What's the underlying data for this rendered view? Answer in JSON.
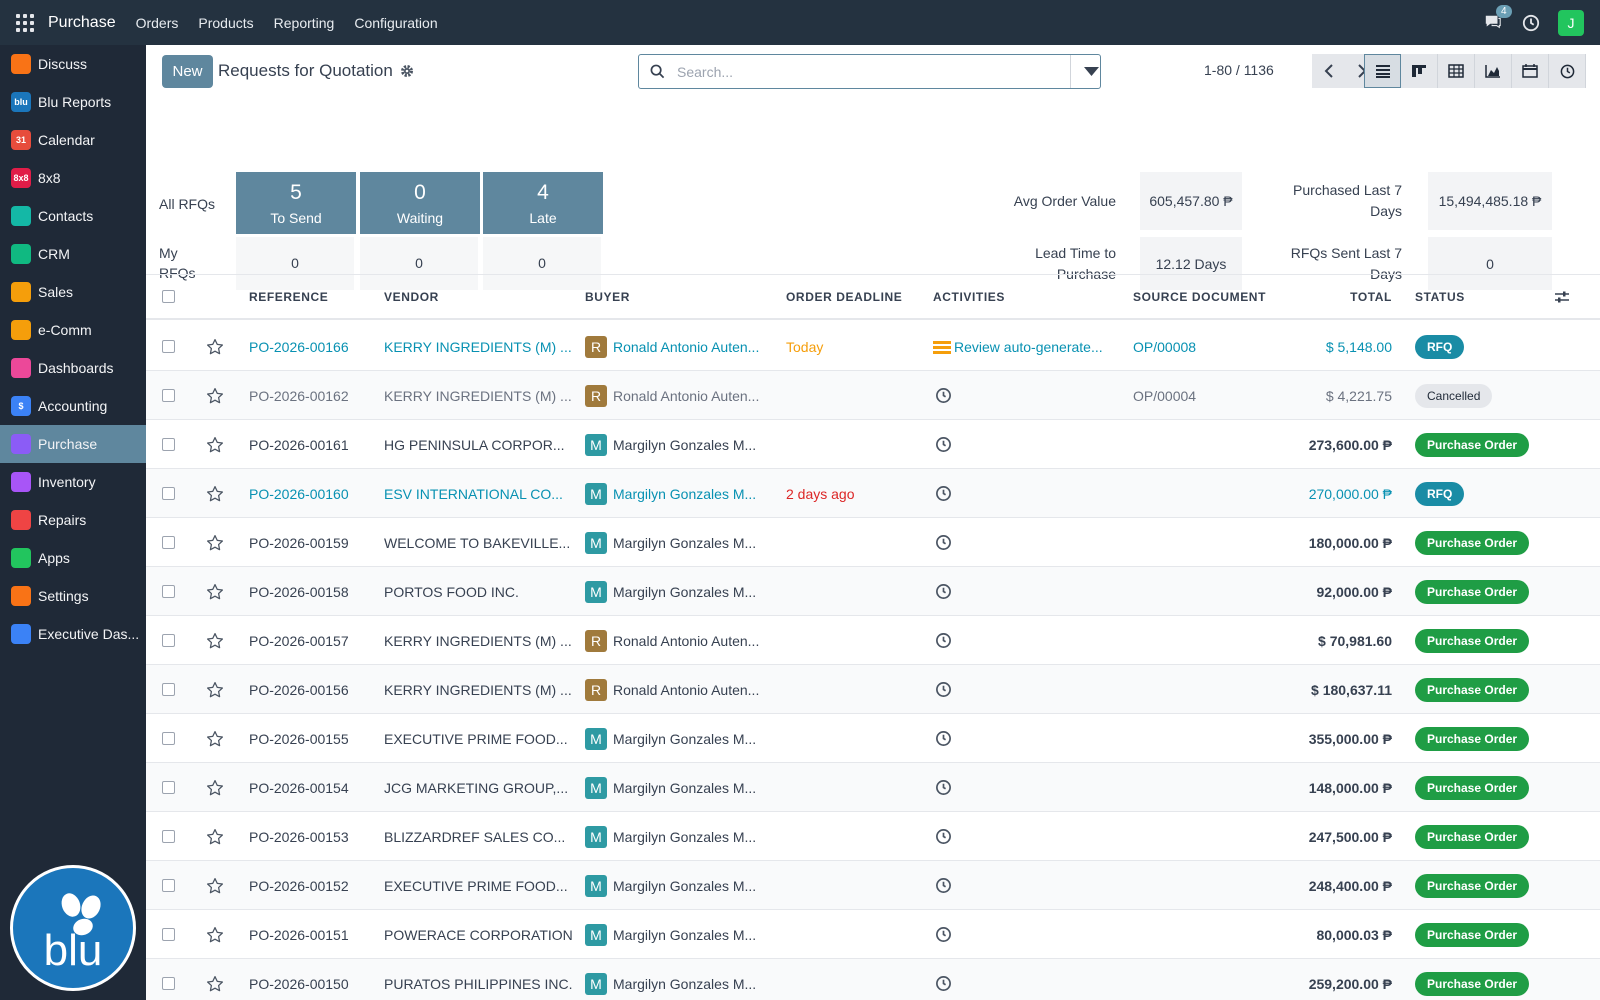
{
  "topbar": {
    "app_name": "Purchase",
    "menus": [
      "Orders",
      "Products",
      "Reporting",
      "Configuration"
    ],
    "chat_count": "4",
    "user_initial": "J"
  },
  "sidebar": {
    "items": [
      {
        "label": "Discuss",
        "icon": "discuss-icon",
        "color": "#f97316"
      },
      {
        "label": "Blu Reports",
        "icon": "blu-reports-icon",
        "color": "#1b76bb"
      },
      {
        "label": "Calendar",
        "icon": "calendar-icon",
        "color": "#e74c3c"
      },
      {
        "label": "8x8",
        "icon": "8x8-icon",
        "color": "#e11d48"
      },
      {
        "label": "Contacts",
        "icon": "contacts-icon",
        "color": "#14b8a6"
      },
      {
        "label": "CRM",
        "icon": "crm-icon",
        "color": "#10b981"
      },
      {
        "label": "Sales",
        "icon": "sales-icon",
        "color": "#f59e0b"
      },
      {
        "label": "e-Comm",
        "icon": "ecomm-icon",
        "color": "#f59e0b"
      },
      {
        "label": "Dashboards",
        "icon": "dashboards-icon",
        "color": "#ec4899"
      },
      {
        "label": "Accounting",
        "icon": "accounting-icon",
        "color": "#3b82f6"
      },
      {
        "label": "Purchase",
        "icon": "purchase-icon",
        "color": "#8b5cf6"
      },
      {
        "label": "Inventory",
        "icon": "inventory-icon",
        "color": "#a855f7"
      },
      {
        "label": "Repairs",
        "icon": "repairs-icon",
        "color": "#ef4444"
      },
      {
        "label": "Apps",
        "icon": "apps-grid-icon",
        "color": "#22c55e"
      },
      {
        "label": "Settings",
        "icon": "settings-icon",
        "color": "#f97316"
      },
      {
        "label": "Executive Das...",
        "icon": "executive-dashboard-icon",
        "color": "#3b82f6"
      }
    ],
    "active_index": 10,
    "logo_text": "blu"
  },
  "control": {
    "new_label": "New",
    "title": "Requests for Quotation",
    "search_placeholder": "Search...",
    "pager": "1-80 / 1136"
  },
  "dashboard": {
    "all_rfqs_label": "All RFQs",
    "my_rfqs_label": "My RFQs",
    "tiles": [
      {
        "count": "5",
        "label": "To Send"
      },
      {
        "count": "0",
        "label": "Waiting"
      },
      {
        "count": "4",
        "label": "Late"
      }
    ],
    "my_counts": [
      "0",
      "0",
      "0"
    ],
    "stats": {
      "avg_order_label": "Avg Order Value",
      "avg_order_value": "605,457.80 ₱",
      "purchased_label": "Purchased Last 7 Days",
      "purchased_value": "15,494,485.18 ₱",
      "lead_time_label": "Lead Time to Purchase",
      "lead_time_value": "12.12 Days",
      "rfqs_sent_label": "RFQs Sent Last 7 Days",
      "rfqs_sent_value": "0"
    }
  },
  "table": {
    "headers": [
      "REFERENCE",
      "VENDOR",
      "BUYER",
      "ORDER DEADLINE",
      "ACTIVITIES",
      "SOURCE DOCUMENT",
      "TOTAL",
      "STATUS"
    ],
    "rows": [
      {
        "ref": "PO-2026-00166",
        "vendor": "KERRY INGREDIENTS (M) ...",
        "buyer_initial": "R",
        "buyer": "Ronald Antonio Auten...",
        "deadline": "Today",
        "activity": "Review auto-generate...",
        "source": "OP/00008",
        "total": "$ 5,148.00",
        "status": "RFQ",
        "style": "highlight"
      },
      {
        "ref": "PO-2026-00162",
        "vendor": "KERRY INGREDIENTS (M) ...",
        "buyer_initial": "R",
        "buyer": "Ronald Antonio Auten...",
        "deadline": "",
        "activity": "",
        "source": "OP/00004",
        "total": "$ 4,221.75",
        "status": "Cancelled",
        "style": "cancel"
      },
      {
        "ref": "PO-2026-00161",
        "vendor": "HG PENINSULA CORPOR...",
        "buyer_initial": "M",
        "buyer": "Margilyn Gonzales M...",
        "deadline": "",
        "activity": "",
        "source": "",
        "total": "273,600.00 ₱",
        "status": "Purchase Order",
        "style": "po"
      },
      {
        "ref": "PO-2026-00160",
        "vendor": "ESV INTERNATIONAL CO...",
        "buyer_initial": "M",
        "buyer": "Margilyn Gonzales M...",
        "deadline": "2 days ago",
        "activity": "",
        "source": "",
        "total": "270,000.00 ₱",
        "status": "RFQ",
        "style": "highlight"
      },
      {
        "ref": "PO-2026-00159",
        "vendor": "WELCOME TO BAKEVILLE...",
        "buyer_initial": "M",
        "buyer": "Margilyn Gonzales M...",
        "deadline": "",
        "activity": "",
        "source": "",
        "total": "180,000.00 ₱",
        "status": "Purchase Order",
        "style": "po"
      },
      {
        "ref": "PO-2026-00158",
        "vendor": "PORTOS FOOD INC.",
        "buyer_initial": "M",
        "buyer": "Margilyn Gonzales M...",
        "deadline": "",
        "activity": "",
        "source": "",
        "total": "92,000.00 ₱",
        "status": "Purchase Order",
        "style": "po"
      },
      {
        "ref": "PO-2026-00157",
        "vendor": "KERRY INGREDIENTS (M) ...",
        "buyer_initial": "R",
        "buyer": "Ronald Antonio Auten...",
        "deadline": "",
        "activity": "",
        "source": "",
        "total": "$ 70,981.60",
        "status": "Purchase Order",
        "style": "po"
      },
      {
        "ref": "PO-2026-00156",
        "vendor": "KERRY INGREDIENTS (M) ...",
        "buyer_initial": "R",
        "buyer": "Ronald Antonio Auten...",
        "deadline": "",
        "activity": "",
        "source": "",
        "total": "$ 180,637.11",
        "status": "Purchase Order",
        "style": "po"
      },
      {
        "ref": "PO-2026-00155",
        "vendor": "EXECUTIVE PRIME FOOD...",
        "buyer_initial": "M",
        "buyer": "Margilyn Gonzales M...",
        "deadline": "",
        "activity": "",
        "source": "",
        "total": "355,000.00 ₱",
        "status": "Purchase Order",
        "style": "po"
      },
      {
        "ref": "PO-2026-00154",
        "vendor": "JCG MARKETING GROUP,...",
        "buyer_initial": "M",
        "buyer": "Margilyn Gonzales M...",
        "deadline": "",
        "activity": "",
        "source": "",
        "total": "148,000.00 ₱",
        "status": "Purchase Order",
        "style": "po"
      },
      {
        "ref": "PO-2026-00153",
        "vendor": "BLIZZARDREF SALES CO...",
        "buyer_initial": "M",
        "buyer": "Margilyn Gonzales M...",
        "deadline": "",
        "activity": "",
        "source": "",
        "total": "247,500.00 ₱",
        "status": "Purchase Order",
        "style": "po"
      },
      {
        "ref": "PO-2026-00152",
        "vendor": "EXECUTIVE PRIME FOOD...",
        "buyer_initial": "M",
        "buyer": "Margilyn Gonzales M...",
        "deadline": "",
        "activity": "",
        "source": "",
        "total": "248,400.00 ₱",
        "status": "Purchase Order",
        "style": "po"
      },
      {
        "ref": "PO-2026-00151",
        "vendor": "POWERACE CORPORATION",
        "buyer_initial": "M",
        "buyer": "Margilyn Gonzales M...",
        "deadline": "",
        "activity": "",
        "source": "",
        "total": "80,000.03 ₱",
        "status": "Purchase Order",
        "style": "po"
      },
      {
        "ref": "PO-2026-00150",
        "vendor": "PURATOS PHILIPPINES INC.",
        "buyer_initial": "M",
        "buyer": "Margilyn Gonzales M...",
        "deadline": "",
        "activity": "",
        "source": "",
        "total": "259,200.00 ₱",
        "status": "Purchase Order",
        "style": "po"
      }
    ]
  },
  "colors": {
    "topbar": "#243240",
    "sidebar": "#1f2937",
    "primary": "#5f879e",
    "link": "#0891b2",
    "today": "#f59e0b",
    "overdue": "#dc2626",
    "status_po": "#1f9d45",
    "status_rfq": "#1a8ca5",
    "buyer_r": "#a07a3c",
    "buyer_m": "#2e9aa3"
  }
}
